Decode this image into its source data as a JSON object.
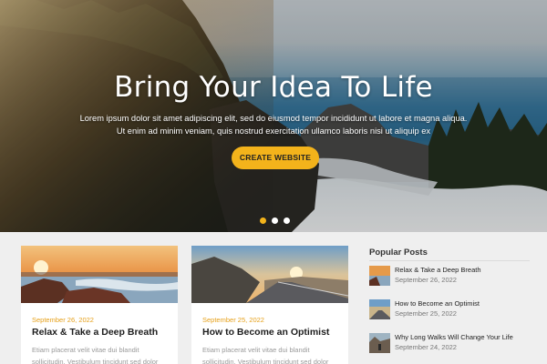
{
  "hero": {
    "title": "Bring Your Idea To Life",
    "text_line1": "Lorem ipsum dolor sit amet adipiscing elit, sed do eiusmod tempor incididunt ut labore et magna aliqua.",
    "text_line2": "Ut enim ad minim veniam, quis nostrud exercitation ullamco laboris nisi ut aliquip ex",
    "cta_label": "CREATE WEBSITE",
    "slides": 3,
    "active_slide": 1,
    "accent_color": "#f3b31b"
  },
  "posts": [
    {
      "date": "September 26, 2022",
      "title": "Relax & Take a Deep Breath",
      "excerpt": "Etiam placerat velit vitae dui blandit sollicitudin. Vestibulum tincidunt sed dolor"
    },
    {
      "date": "September 25, 2022",
      "title": "How to Become an Optimist",
      "excerpt": "Etiam placerat velit vitae dui blandit sollicitudin. Vestibulum tincidunt sed dolor"
    }
  ],
  "sidebar": {
    "title": "Popular Posts",
    "items": [
      {
        "title": "Relax & Take a Deep Breath",
        "date": "September 26, 2022"
      },
      {
        "title": "How to Become an Optimist",
        "date": "September 25, 2022"
      },
      {
        "title": "Why Long Walks Will Change Your Life",
        "date": "September 24, 2022"
      }
    ]
  }
}
